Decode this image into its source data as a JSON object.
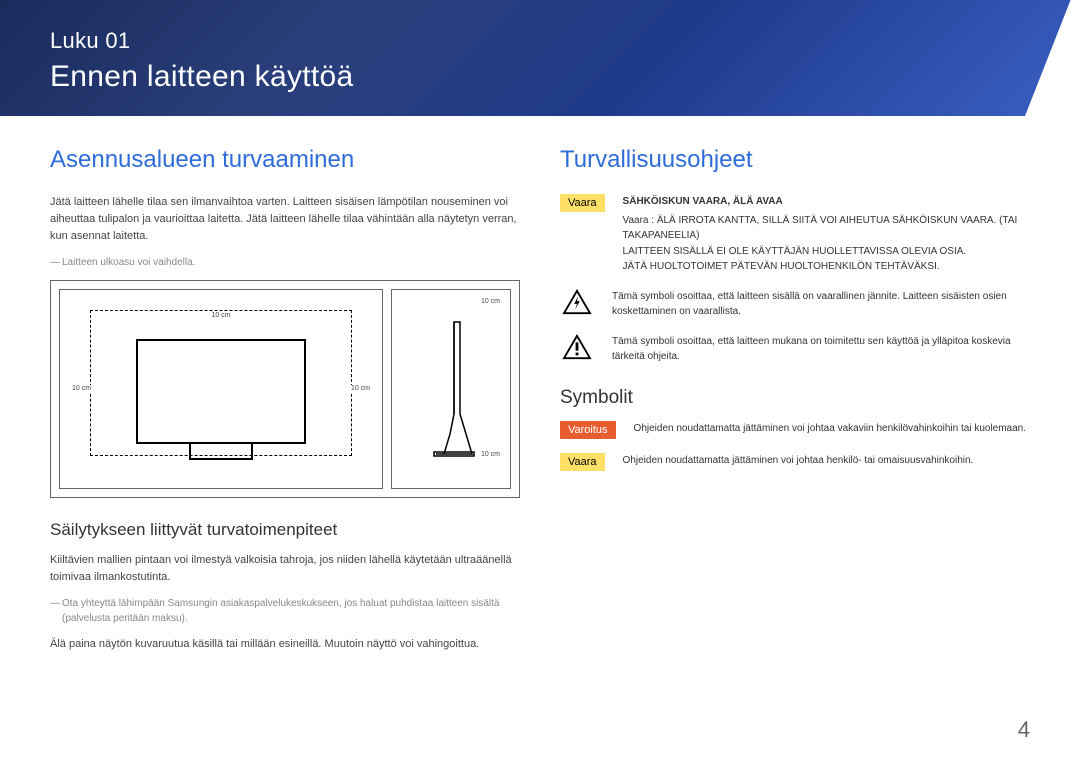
{
  "header": {
    "chapter_label": "Luku 01",
    "chapter_title": "Ennen laitteen käyttöä"
  },
  "left": {
    "heading": "Asennusalueen turvaaminen",
    "intro": "Jätä laitteen lähelle tilaa sen ilmanvaihtoa varten. Laitteen sisäisen lämpötilan nouseminen voi aiheuttaa tulipalon ja vaurioittaa laitetta. Jätä laitteen lähelle tilaa vähintään alla näytetyn verran, kun asennat laitetta.",
    "note1": "Laitteen ulkoasu voi vaihdella.",
    "diagram": {
      "top": "10 cm",
      "left": "10 cm",
      "right": "10 cm",
      "top2": "10 cm",
      "bottom2": "10 cm"
    },
    "sub_heading": "Säilytykseen liittyvät turvatoimenpiteet",
    "storage_text": "Kiiltävien mallien pintaan voi ilmestyä valkoisia tahroja, jos niiden lähellä käytetään ultraäänellä toimivaa ilmankostutinta.",
    "note2": "Ota yhteyttä lähimpään Samsungin asiakaspalvelukeskukseen, jos haluat puhdistaa laitteen sisältä (palvelusta peritään maksu).",
    "press_text": "Älä paina näytön kuvaruutua käsillä tai millään esineillä. Muutoin näyttö voi vahingoittua."
  },
  "right": {
    "heading": "Turvallisuusohjeet",
    "danger_badge": "Vaara",
    "danger_block": {
      "bold": "SÄHKÖISKUN VAARA, ÄLÄ AVAA",
      "line1": "Vaara : ÄLÄ IRROTA KANTTA, SILLÄ SIITÄ VOI AIHEUTUA SÄHKÖISKUN VAARA. (TAI TAKAPANEELIA)",
      "line2": "LAITTEEN SISÄLLÄ EI OLE KÄYTTÄJÄN HUOLLETTAVISSA OLEVIA OSIA.",
      "line3": "JÄTÄ HUOLTOTOIMET PÄTEVÄN HUOLTOHENKILÖN TEHTÄVÄKSI."
    },
    "symbol1": "Tämä symboli osoittaa, että laitteen sisällä on vaarallinen jännite. Laitteen sisäisten osien koskettaminen on vaarallista.",
    "symbol2": "Tämä symboli osoittaa, että laitteen mukana on toimitettu sen käyttöä ja ylläpitoa koskevia tärkeitä ohjeita.",
    "symbols_heading": "Symbolit",
    "warn_badge": "Varoitus",
    "warn_text": "Ohjeiden noudattamatta jättäminen voi johtaa vakaviin henkilövahinkoihin tai kuolemaan.",
    "danger2_badge": "Vaara",
    "danger2_text": "Ohjeiden noudattamatta jättäminen voi johtaa henkilö- tai omaisuusvahinkoihin."
  },
  "page_number": "4"
}
